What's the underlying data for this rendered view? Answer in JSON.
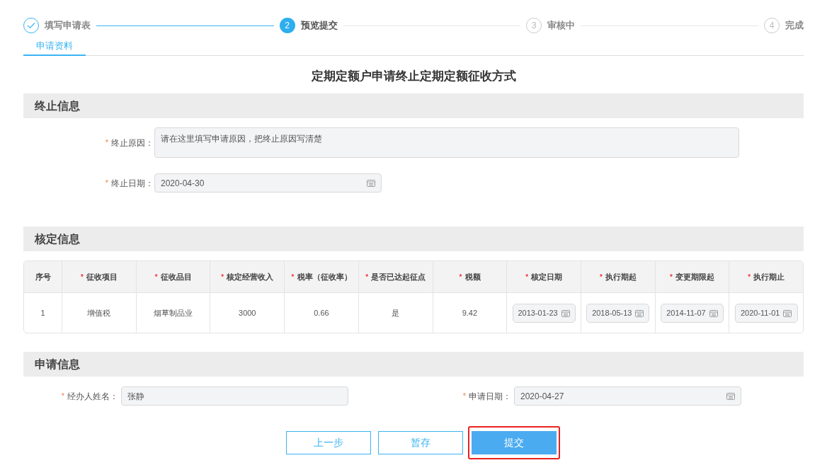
{
  "steps": [
    {
      "label": "填写申请表",
      "done": true,
      "selected": false
    },
    {
      "number": "2",
      "label": "预览提交",
      "done": false,
      "selected": true
    },
    {
      "number": "3",
      "label": "审核中",
      "done": false,
      "selected": false
    },
    {
      "number": "4",
      "label": "完成",
      "done": false,
      "selected": false
    }
  ],
  "tabs": [
    {
      "label": "申请资料",
      "selected": true
    }
  ],
  "title": "定期定额户申请终止定期定额征收方式",
  "termination": {
    "heading": "终止信息",
    "reason": {
      "mark": "*",
      "label": "终止原因：",
      "placeholder": "请在这里填写申请原因，把终止原因写清楚"
    },
    "date": {
      "mark": "*",
      "label": "终止日期：",
      "value": "2020-04-30"
    }
  },
  "assessment": {
    "heading": "核定信息",
    "table": {
      "columns": [
        {
          "label": "序号"
        },
        {
          "mark": "*",
          "label": "征收项目"
        },
        {
          "mark": "*",
          "label": "征收品目"
        },
        {
          "mark": "*",
          "label": "核定经营收入"
        },
        {
          "mark": "*",
          "label": "税率（征收率）"
        },
        {
          "mark": "*",
          "label": "是否已达起征点"
        },
        {
          "mark": "*",
          "label": "税额"
        },
        {
          "mark": "*",
          "label": "核定日期"
        },
        {
          "mark": "*",
          "label": "执行期起"
        },
        {
          "mark": "*",
          "label": "变更期限起"
        },
        {
          "mark": "*",
          "label": "执行期止"
        }
      ],
      "rows": [
        [
          {
            "kind": "text",
            "value": "1"
          },
          {
            "kind": "text",
            "value": "增值税"
          },
          {
            "kind": "text",
            "value": "烟草制品业"
          },
          {
            "kind": "text",
            "value": "3000"
          },
          {
            "kind": "text",
            "value": "0.66"
          },
          {
            "kind": "text",
            "value": "是"
          },
          {
            "kind": "text",
            "value": "9.42"
          },
          {
            "kind": "date",
            "value": "2013-01-23"
          },
          {
            "kind": "date",
            "value": "2018-05-13"
          },
          {
            "kind": "date",
            "value": "2014-11-07"
          },
          {
            "kind": "date",
            "value": "2020-11-01"
          }
        ]
      ]
    }
  },
  "application": {
    "heading": "申请信息",
    "handler": {
      "mark": "*",
      "label": "经办人姓名：",
      "value": "张静"
    },
    "date": {
      "mark": "*",
      "label": "申请日期：",
      "value": "2020-04-27"
    }
  },
  "buttons": [
    {
      "label": "上一步",
      "kind": "outline",
      "highlighted": false
    },
    {
      "label": "暂存",
      "kind": "outline",
      "highlighted": false
    },
    {
      "label": "提交",
      "kind": "primary",
      "highlighted": true
    }
  ]
}
